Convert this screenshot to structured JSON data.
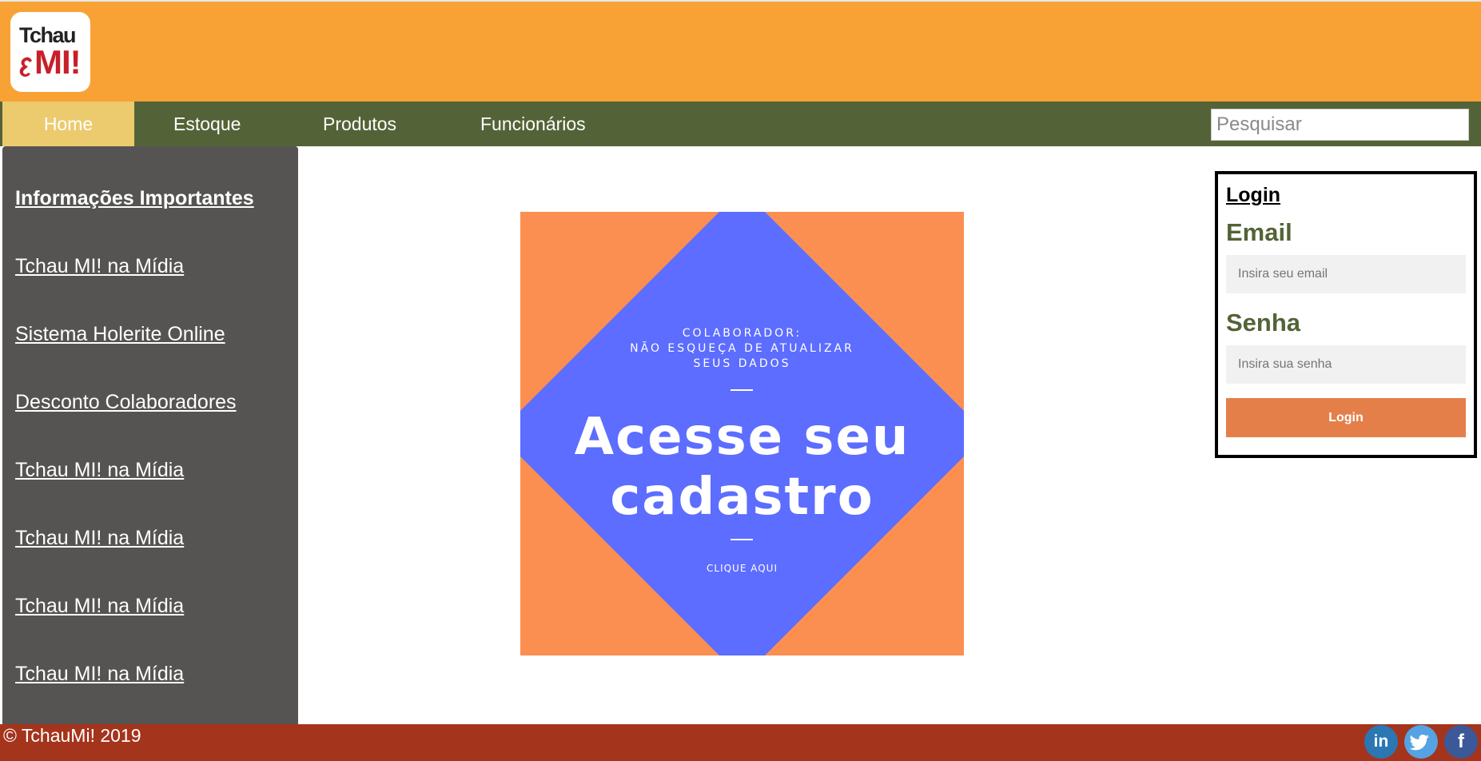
{
  "header": {
    "logo": {
      "line1": "Tchau",
      "line2": "MI!"
    }
  },
  "nav": {
    "items": [
      {
        "label": "Home",
        "active": true
      },
      {
        "label": "Estoque"
      },
      {
        "label": "Produtos"
      },
      {
        "label": "Funcionários"
      }
    ],
    "search_placeholder": "Pesquisar"
  },
  "sidebar": {
    "title": "Informações Importantes",
    "links": [
      "Tchau MI! na Mídia",
      "Sistema Holerite Online",
      "Desconto Colaboradores",
      "Tchau MI! na Mídia",
      "Tchau MI! na Mídia",
      "Tchau MI! na Mídia",
      "Tchau MI! na Mídia"
    ]
  },
  "banner": {
    "line1": "COLABORADOR:",
    "line2": "NÃO ESQUEÇA DE ATUALIZAR",
    "line3": "SEUS DADOS",
    "title_line1": "Acesse seu",
    "title_line2": "cadastro",
    "cta": "CLIQUE AQUI"
  },
  "login": {
    "title": "Login",
    "email_label": "Email",
    "email_placeholder": "Insira seu email",
    "password_label": "Senha",
    "password_placeholder": "Insira sua senha",
    "button": "Login"
  },
  "footer": {
    "copyright": "© TchauMi! 2019",
    "social": [
      {
        "icon": "linkedin-icon",
        "glyph": "in",
        "color": "#2a77b4"
      },
      {
        "icon": "twitter-icon",
        "glyph": "",
        "color": "#55a3e3"
      },
      {
        "icon": "facebook-icon",
        "glyph": "f",
        "color": "#3b5998"
      }
    ]
  },
  "colors": {
    "header": "#f8a236",
    "nav": "#546337",
    "nav_active": "#eccb6e",
    "sidebar": "#555452",
    "footer": "#a4341c",
    "banner_orange": "#fb8f52",
    "banner_blue": "#5c6dff",
    "login_button": "#e57f4a"
  }
}
